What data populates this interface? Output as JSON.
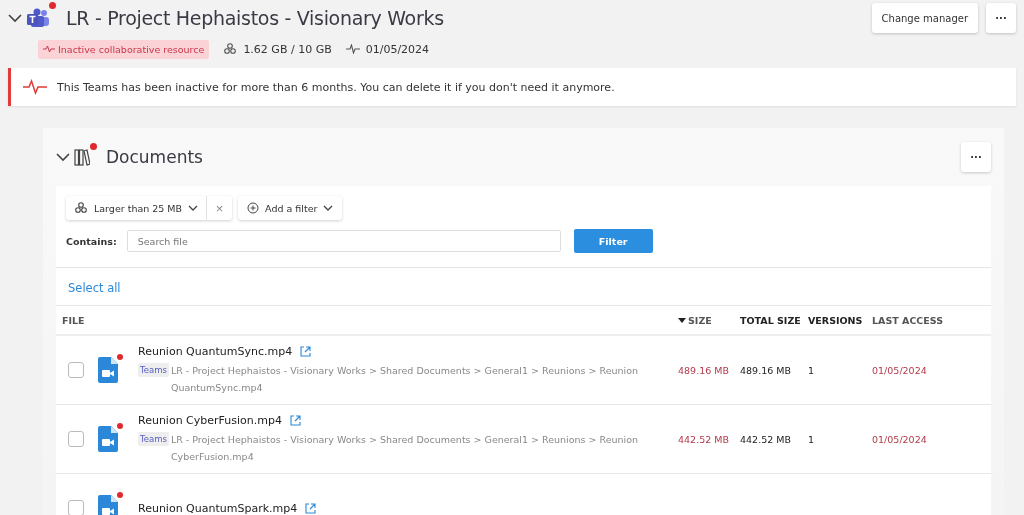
{
  "header": {
    "title": "LR - Project Hephaistos - Visionary Works",
    "notification": true,
    "status_badge": "Inactive collaborative resource",
    "storage": "1.62 GB / 10 GB",
    "last_activity": "01/05/2024",
    "buttons": [
      "Change manager",
      "···"
    ]
  },
  "alert": {
    "message": "This Teams has been inactive for more than 6 months. You can delete it if you don't need it anymore."
  },
  "documents": {
    "title": "Documents",
    "notification": true,
    "menu_button": "···",
    "filters": {
      "active_filter": "Larger than 25 MB",
      "remove": "×",
      "add_filter": "Add a filter",
      "contains_label": "Contains:",
      "search_placeholder": "Search file",
      "filter_button": "Filter"
    },
    "select_all": "Select all",
    "table": {
      "columns": [
        {
          "label": "FILE",
          "sorted": false
        },
        {
          "label": "SIZE",
          "sorted": true
        },
        {
          "label": "TOTAL SIZE",
          "sorted": false
        },
        {
          "label": "VERSIONS",
          "sorted": false
        },
        {
          "label": "LAST ACCESS",
          "sorted": false
        }
      ],
      "rows": [
        {
          "name": "Reunion QuantumSync.mp4",
          "checked": false,
          "new": true,
          "source": "Teams",
          "path": "LR - Project Hephaistos - Visionary Works > Shared Documents > General1 > Reunions > Reunion QuantumSync.mp4",
          "size": "489.16 MB",
          "total_size": "489.16 MB",
          "versions": "1",
          "last_access": "01/05/2024"
        },
        {
          "name": "Reunion CyberFusion.mp4",
          "checked": false,
          "new": true,
          "source": "Teams",
          "path": "LR - Project Hephaistos - Visionary Works > Shared Documents > General1 > Reunions > Reunion CyberFusion.mp4",
          "size": "442.52 MB",
          "total_size": "442.52 MB",
          "versions": "1",
          "last_access": "01/05/2024"
        },
        {
          "name": "Reunion QuantumSpark.mp4",
          "checked": false,
          "new": true
        }
      ]
    }
  }
}
